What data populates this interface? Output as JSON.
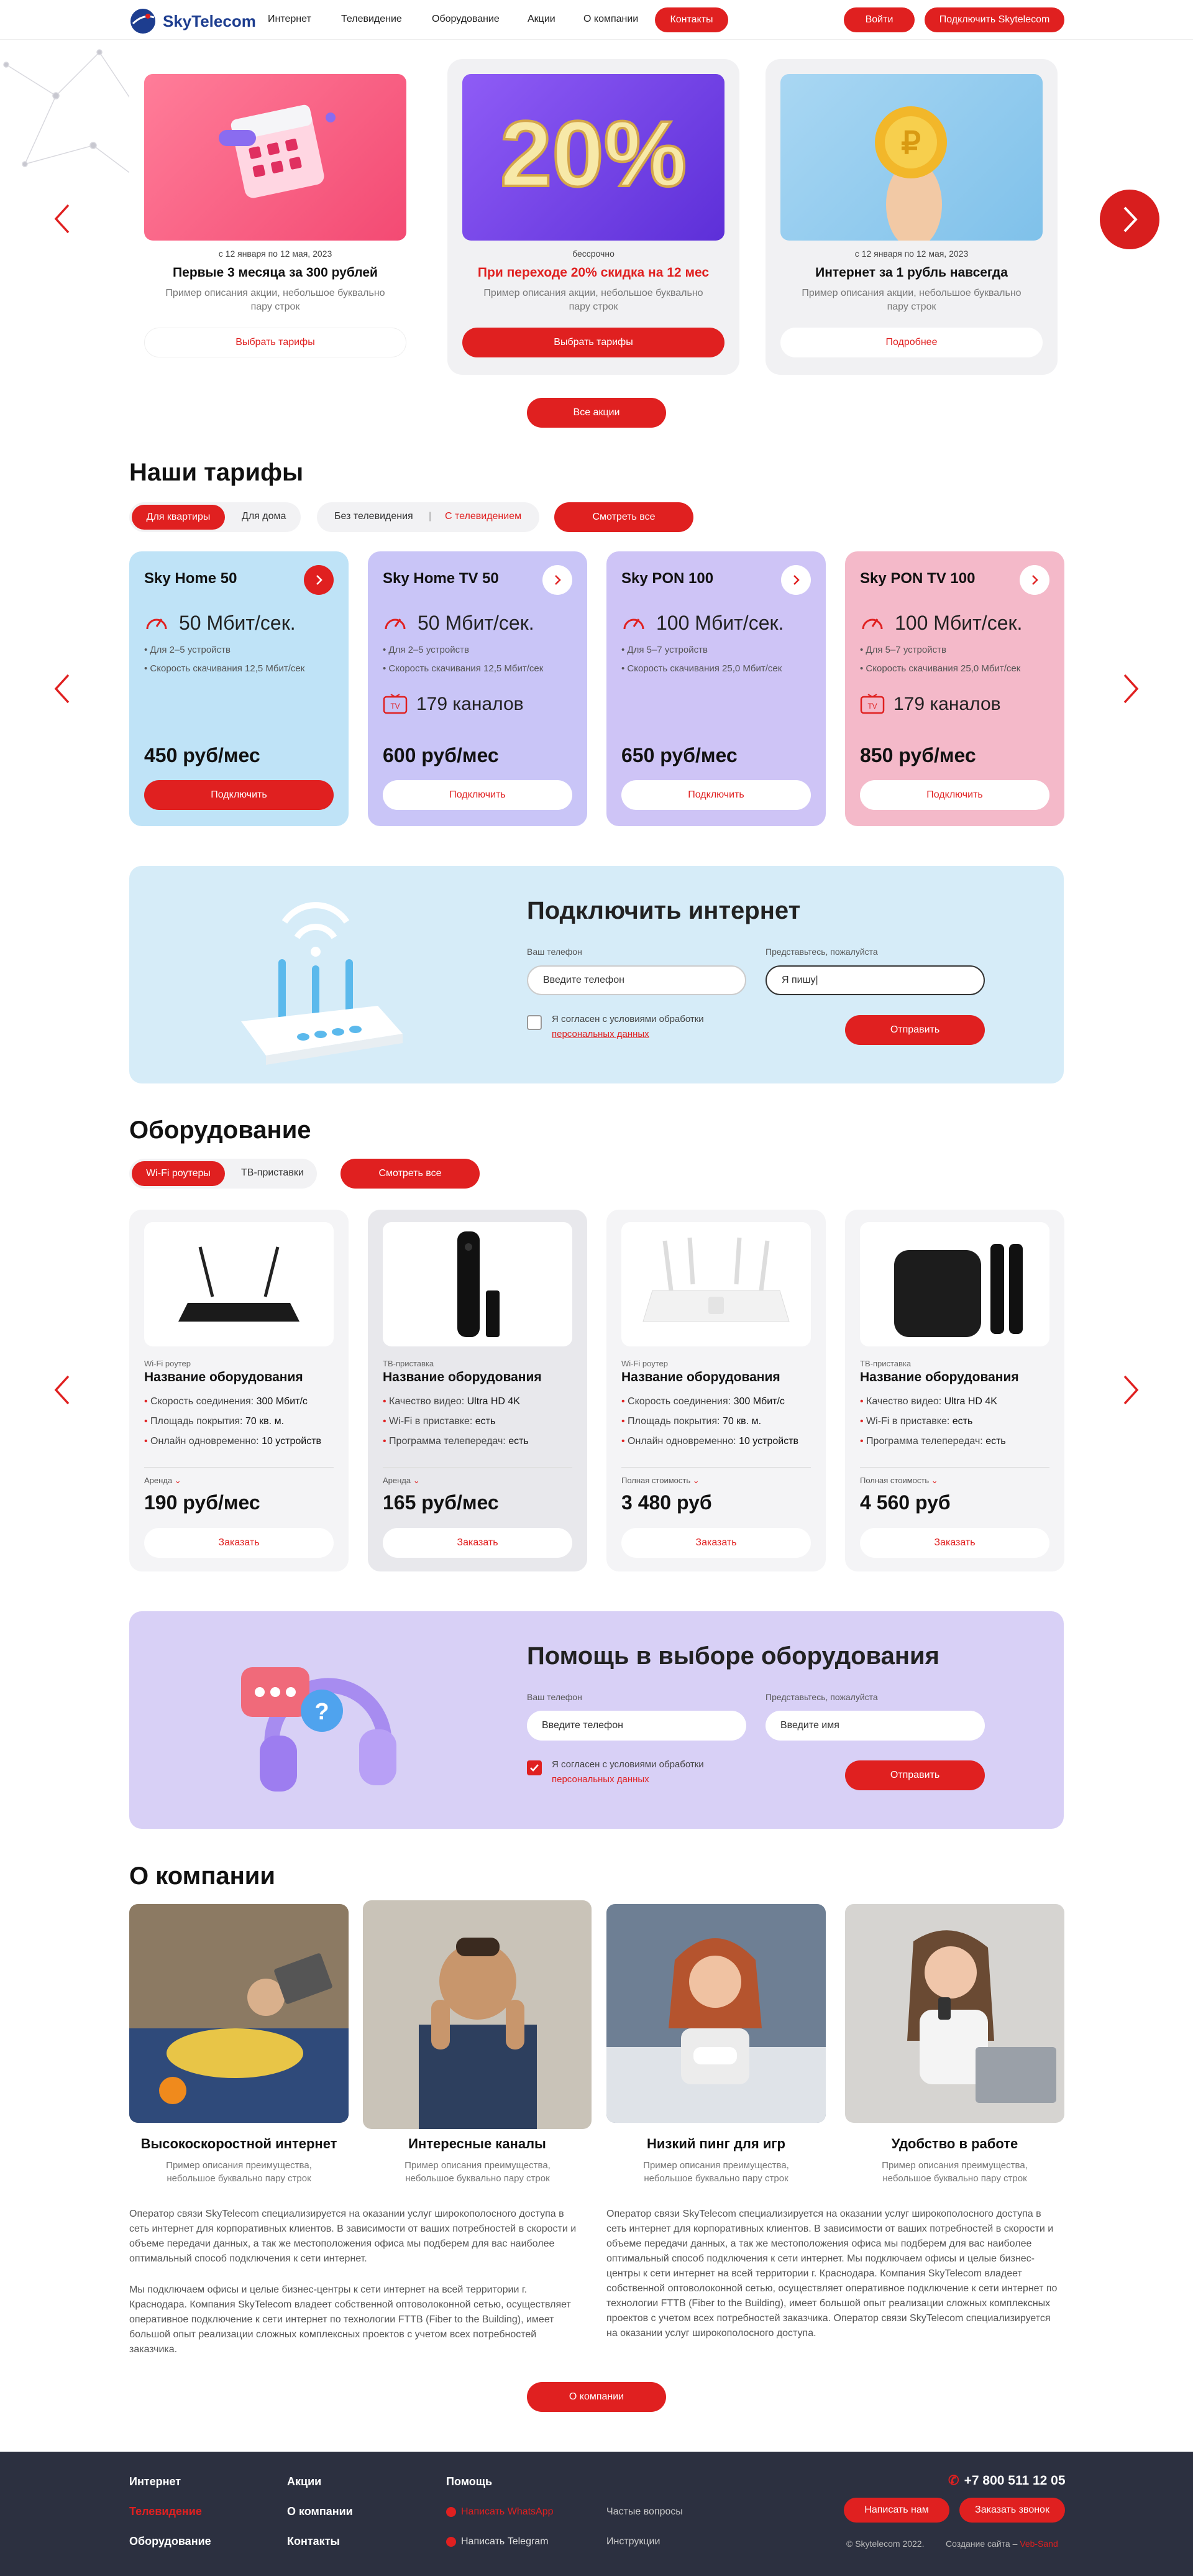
{
  "header": {
    "logo": "SkyTelecom",
    "nav": [
      "Интернет",
      "Телевидение",
      "Оборудование",
      "Акции",
      "О компании",
      "Контакты"
    ],
    "login": "Войти",
    "connect": "Подключить Skytelecom"
  },
  "promos": [
    {
      "date": "с 12 января по 12 мая, 2023",
      "title": "Первые 3 месяца за 300 рублей",
      "desc": "Пример описания акции, небольшое буквально пару строк",
      "button": "Выбрать тарифы"
    },
    {
      "date": "бессрочно",
      "title": "При переходе 20% скидка на 12 мес",
      "desc": "Пример описания акции, небольшое буквально пару строк",
      "button": "Выбрать тарифы",
      "badge": "20%"
    },
    {
      "date": "с 12 января по 12 мая, 2023",
      "title": "Интернет за 1 рубль навсегда",
      "desc": "Пример описания акции, небольшое буквально пару строк",
      "button": "Подробнее"
    }
  ],
  "all_promos": "Все акции",
  "tariffs_section": {
    "title": "Наши тарифы",
    "tab_flat": "Для квартиры",
    "tab_house": "Для дома",
    "tab_no_tv": "Без телевидения",
    "tab_sep": "|",
    "tab_tv": "С телевидением",
    "see_all": "Смотреть все",
    "items": [
      {
        "name": "Sky Home 50",
        "speed": "50 Мбит/сек.",
        "f1": "• Для 2–5 устройств",
        "f2": "• Скорость скачивания 12,5 Мбит/сек",
        "channels": "",
        "price": "450 руб/мес",
        "button": "Подключить"
      },
      {
        "name": "Sky Home TV 50",
        "speed": "50 Мбит/сек.",
        "f1": "• Для 2–5 устройств",
        "f2": "• Скорость скачивания 12,5 Мбит/сек",
        "channels": "179 каналов",
        "price": "600 руб/мес",
        "button": "Подключить"
      },
      {
        "name": "Sky PON 100",
        "speed": "100 Мбит/сек.",
        "f1": "• Для 5–7 устройств",
        "f2": "• Скорость скачивания 25,0 Мбит/сек",
        "channels": "",
        "price": "650 руб/мес",
        "button": "Подключить"
      },
      {
        "name": "Sky PON TV 100",
        "speed": "100 Мбит/сек.",
        "f1": "• Для 5–7 устройств",
        "f2": "• Скорость скачивания 25,0 Мбит/сек",
        "channels": "179 каналов",
        "price": "850 руб/мес",
        "button": "Подключить"
      }
    ]
  },
  "connect_form": {
    "title": "Подключить интернет",
    "phone_label": "Ваш телефон",
    "phone_placeholder": "Введите телефон",
    "name_label": "Представьтесь, пожалуйста",
    "name_value": "Я пишу|",
    "agree": "Я согласен с условиями обработки",
    "agree_link": "персональных данных",
    "submit": "Отправить"
  },
  "equipment": {
    "title": "Оборудование",
    "tab_wifi": "Wi-Fi роутеры",
    "tab_tv": "ТВ-приставки",
    "see_all": "Смотреть все",
    "items": [
      {
        "cat": "Wi-Fi роутер",
        "name": "Название оборудования",
        "s1": "Скорость соединения:",
        "v1": "300 Мбит/с",
        "s2": "Площадь покрытия:",
        "v2": "70 кв. м.",
        "s3": "Онлайн одновременно:",
        "v3": "10 устройств",
        "label": "Аренда",
        "price": "190 руб/мес",
        "button": "Заказать"
      },
      {
        "cat": "ТВ-приставка",
        "name": "Название оборудования",
        "s1": "Качество видео:",
        "v1": "Ultra HD 4K",
        "s2": "Wi-Fi в приставке:",
        "v2": "есть",
        "s3": "Программа телепередач:",
        "v3": "есть",
        "label": "Аренда",
        "price": "165 руб/мес",
        "button": "Заказать"
      },
      {
        "cat": "Wi-Fi роутер",
        "name": "Название оборудования",
        "s1": "Скорость соединения:",
        "v1": "300 Мбит/с",
        "s2": "Площадь покрытия:",
        "v2": "70 кв. м.",
        "s3": "Онлайн одновременно:",
        "v3": "10 устройств",
        "label": "Полная стоимость",
        "price": "3 480 руб",
        "button": "Заказать"
      },
      {
        "cat": "ТВ-приставка",
        "name": "Название оборудования",
        "s1": "Качество видео:",
        "v1": "Ultra HD 4K",
        "s2": "Wi-Fi в приставке:",
        "v2": "есть",
        "s3": "Программа телепередач:",
        "v3": "есть",
        "label": "Полная стоимость",
        "price": "4 560 руб",
        "button": "Заказать"
      }
    ]
  },
  "help_form": {
    "title": "Помощь в выборе оборудования",
    "phone_label": "Ваш телефон",
    "phone_placeholder": "Введите телефон",
    "name_label": "Представьтесь, пожалуйста",
    "name_placeholder": "Введите имя",
    "agree": "Я согласен с условиями обработки",
    "agree_link": "персональных данных",
    "submit": "Отправить"
  },
  "company": {
    "title": "О компании",
    "cards": [
      {
        "title": "Высокоскоростной интернет",
        "desc": "Пример описания преимущества, небольшое буквально пару строк"
      },
      {
        "title": "Интересные каналы",
        "desc": "Пример описания преимущества, небольшое буквально пару строк"
      },
      {
        "title": "Низкий пинг для игр",
        "desc": "Пример описания преимущества, небольшое буквально пару строк"
      },
      {
        "title": "Удобство в работе",
        "desc": "Пример описания преимущества, небольшое буквально пару строк"
      }
    ],
    "p1": "Оператор связи SkyTelecom специализируется на оказании услуг широкополосного доступа в сеть интернет для корпоративных клиентов. В зависимости от ваших потребностей в скорости и объеме передачи данных, а так же местоположения офиса мы подберем для вас наиболее оптимальный способ подключения к сети интернет.",
    "p2": "Мы подключаем офисы и целые бизнес-центры к сети интернет на всей территории г. Краснодара. Компания SkyTelecom владеет собственной оптоволоконной сетью, осуществляет оперативное подключение к сети интернет по технологии FTTB (Fiber to the Building), имеет большой опыт реализации сложных комплексных проектов с учетом всех потребностей заказчика.",
    "p3": "Оператор связи SkyTelecom специализируется на оказании услуг широкополосного доступа в сеть интернет для корпоративных клиентов. В зависимости от ваших потребностей в скорости и объеме передачи данных, а так же местоположения офиса мы подберем для вас наиболее оптимальный способ подключения к сети интернет. Мы подключаем офисы и целые бизнес-центры к сети интернет на всей территории г. Краснодара. Компания SkyTelecom владеет собственной оптоволоконной сетью, осуществляет оперативное подключение к сети интернет по технологии FTTB (Fiber to the Building), имеет большой опыт реализации сложных комплексных проектов с учетом всех потребностей заказчика. Оператор связи SkyTelecom специализируется на оказании услуг широкополосного доступа.",
    "button": "О компании"
  },
  "footer": {
    "c1": [
      "Интернет",
      "Телевидение",
      "Оборудование"
    ],
    "c2": [
      "Акции",
      "О компании",
      "Контакты"
    ],
    "help": "Помощь",
    "whatsapp": "Написать WhatsApp",
    "telegram": "Написать Telegram",
    "faq": "Частые вопросы",
    "instructions": "Инструкции",
    "phone": "+7 800 511 12 05",
    "write": "Написать нам",
    "call": "Заказать звонок",
    "copyright": "© Skytelecom 2022.",
    "made_by": "Создание сайта –",
    "made_link": "Veb-Sand"
  },
  "colors": {
    "accent": "#e02020",
    "footer_bg": "#2c3040",
    "blue_card": "#bfe3f7",
    "purple_card": "#c9c5f7",
    "violet_card": "#cec4f6",
    "pink_card": "#f4b9c9"
  }
}
